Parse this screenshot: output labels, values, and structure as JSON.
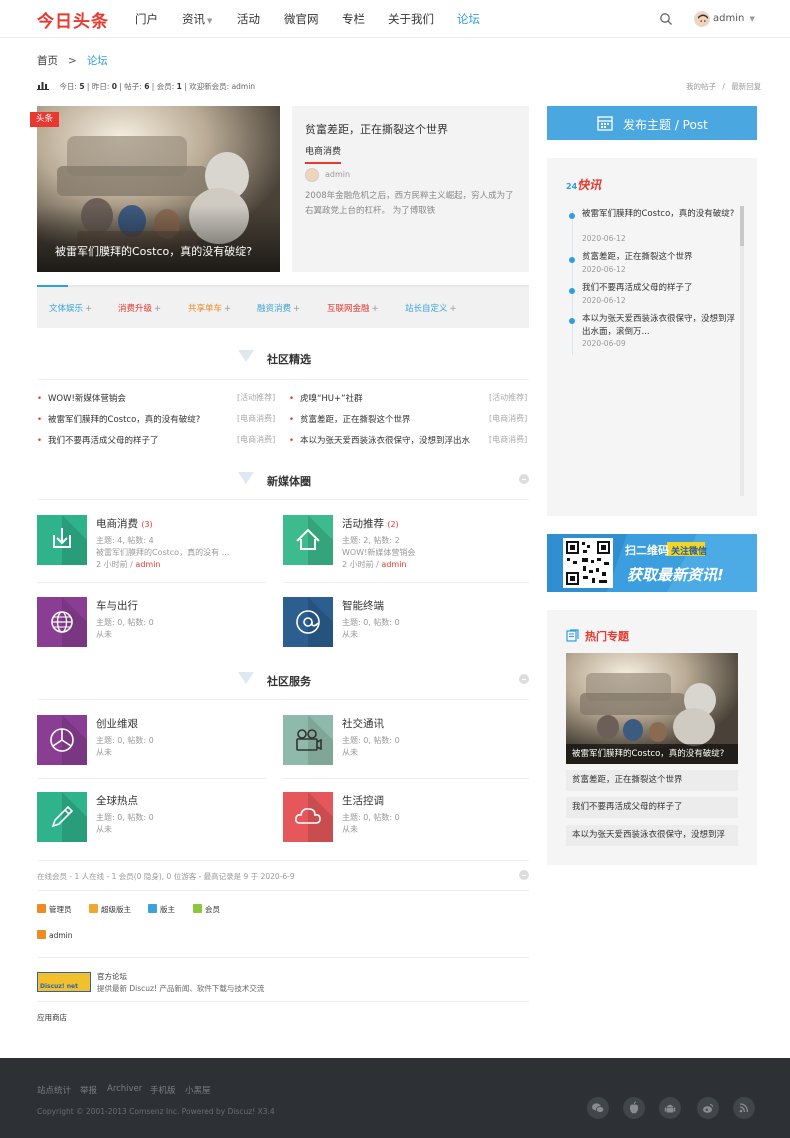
{
  "header": {
    "logo": "今日头条",
    "nav": [
      "门户",
      "资讯",
      "活动",
      "微官网",
      "专栏",
      "关于我们",
      "论坛"
    ],
    "username": "admin"
  },
  "breadcrumb": {
    "home": "首页",
    "sep": ">",
    "current": "论坛"
  },
  "stats": {
    "today_label": "今日:",
    "today": "5",
    "yesterday_label": "昨日:",
    "yesterday": "0",
    "posts_label": "帖子:",
    "posts": "6",
    "members_label": "会员:",
    "members": "1",
    "newest_label": "欢迎新会员:",
    "newest": "admin"
  },
  "toplinks": {
    "my_posts": "我的帖子",
    "sep": "/",
    "latest": "最新回复"
  },
  "hero": {
    "tag": "头条",
    "caption": "被雷军们膜拜的Costco，真的没有破绽?"
  },
  "card": {
    "title": "贫富差距，正在撕裂这个世界",
    "tag": "电商消费",
    "user": "admin",
    "desc": "2008年金融危机之后，西方民粹主义崛起，穷人成为了右翼政党上台的杠杆。 为了博取铁"
  },
  "categories": [
    {
      "label": "文体娱乐",
      "color": "#3aa3d8"
    },
    {
      "label": "消费升级",
      "color": "#e8382f"
    },
    {
      "label": "共享单车",
      "color": "#f08a24"
    },
    {
      "label": "融资消费",
      "color": "#3aa3d8"
    },
    {
      "label": "互联网金融",
      "color": "#e8382f"
    },
    {
      "label": "站长自定义",
      "color": "#3aa3d8"
    }
  ],
  "featured": {
    "title": "社区精选",
    "left": [
      {
        "text": "WOW!新媒体营销会",
        "tag": "[活动推荐]"
      },
      {
        "text": "被雷军们膜拜的Costco，真的没有破绽?",
        "tag": "[电商消费]"
      },
      {
        "text": "我们不要再活成父母的样子了",
        "tag": "[电商消费]"
      }
    ],
    "right": [
      {
        "text": "虎嗅“HU+”社群",
        "tag": "[活动推荐]"
      },
      {
        "text": "贫富差距，正在撕裂这个世界",
        "tag": "[电商消费]"
      },
      {
        "text": "本以为张天爱西装泳衣很保守，没想到浮出水",
        "tag": "[电商消费]"
      }
    ]
  },
  "media_circle": {
    "title": "新媒体圈",
    "forums": [
      {
        "name": "电商消费",
        "count": "(3)",
        "stats": "主题: 4, 帖数: 4",
        "last": "被雷军们膜拜的Costco，真的没有 ...",
        "time": "2 小时前",
        "by": "admin",
        "color": "#2fb38b"
      },
      {
        "name": "活动推荐",
        "count": "(2)",
        "stats": "主题: 2, 帖数: 2",
        "last": "WOW!新媒体营销会",
        "time": "2 小时前",
        "by": "admin",
        "color": "#3dbb8f"
      },
      {
        "name": "车与出行",
        "count": "",
        "stats": "主题: 0, 帖数: 0",
        "last": "",
        "time": "从未",
        "by": "",
        "color": "#8a3e93"
      },
      {
        "name": "智能终端",
        "count": "",
        "stats": "主题: 0, 帖数: 0",
        "last": "",
        "time": "从未",
        "by": "",
        "color": "#2c5f8f"
      }
    ]
  },
  "community_service": {
    "title": "社区服务",
    "forums": [
      {
        "name": "创业维艰",
        "stats": "主题: 0, 帖数: 0",
        "time": "从未",
        "color": "#8a3e93"
      },
      {
        "name": "社交通讯",
        "stats": "主题: 0, 帖数: 0",
        "time": "从未",
        "color": "#8fb9aa"
      },
      {
        "name": "全球热点",
        "stats": "主题: 0, 帖数: 0",
        "time": "从未",
        "color": "#2fb38b"
      },
      {
        "name": "生活控调",
        "stats": "主题: 0, 帖数: 0",
        "time": "从未",
        "color": "#e5575a"
      }
    ]
  },
  "online": {
    "text": "在线会员 - 1 人在线 - 1 会员(0 隐身), 0 位游客 - 最高记录是 9 于 2020-6-9",
    "groups": [
      {
        "label": "管理员",
        "color": "#f08a24"
      },
      {
        "label": "超级版主",
        "color": "#f0a830"
      },
      {
        "label": "版主",
        "color": "#3aa3d8"
      },
      {
        "label": "会员",
        "color": "#8dc63f"
      }
    ],
    "user": "admin"
  },
  "links": {
    "logo_text": "Discuz! net",
    "name": "官方论坛",
    "desc": "提供最新 Discuz! 产品新闻、软件下载与技术交流",
    "app_store": "应用商店"
  },
  "sidebar": {
    "post_button": "发布主题 / Post",
    "kuaixun_badge": "24",
    "kuaixun_title": "快讯",
    "news": [
      {
        "title": "被雷军们膜拜的Costco，真的没有破绽?",
        "date": "2020-06-12"
      },
      {
        "title": "贫富差距，正在撕裂这个世界",
        "date": "2020-06-12"
      },
      {
        "title": "我们不要再活成父母的样子了",
        "date": "2020-06-12"
      },
      {
        "title": "本以为张天爱西装泳衣很保守，没想到浮出水面，滚倒万...",
        "date": "2020-06-09"
      }
    ],
    "ad": {
      "line1": "扫二维码",
      "badge": "关注微信",
      "line2": "获取最新资讯!"
    },
    "hot_title": "热门专题",
    "hot_caption": "被雷军们膜拜的Costco，真的没有破绽?",
    "hot_items": [
      "贫富差距，正在撕裂这个世界",
      "我们不要再活成父母的样子了",
      "本以为张天爱西装泳衣很保守，没想到浮"
    ]
  },
  "footer": {
    "links": [
      "站点统计",
      "举报",
      "Archiver",
      "手机版",
      "小黑屋"
    ],
    "copyright": "Copyright © 2001-2013 Comsenz Inc. Powered by Discuz! X3.4",
    "social_icons": [
      "wechat-icon",
      "apple-icon",
      "android-icon",
      "weibo-icon",
      "rss-icon"
    ]
  }
}
